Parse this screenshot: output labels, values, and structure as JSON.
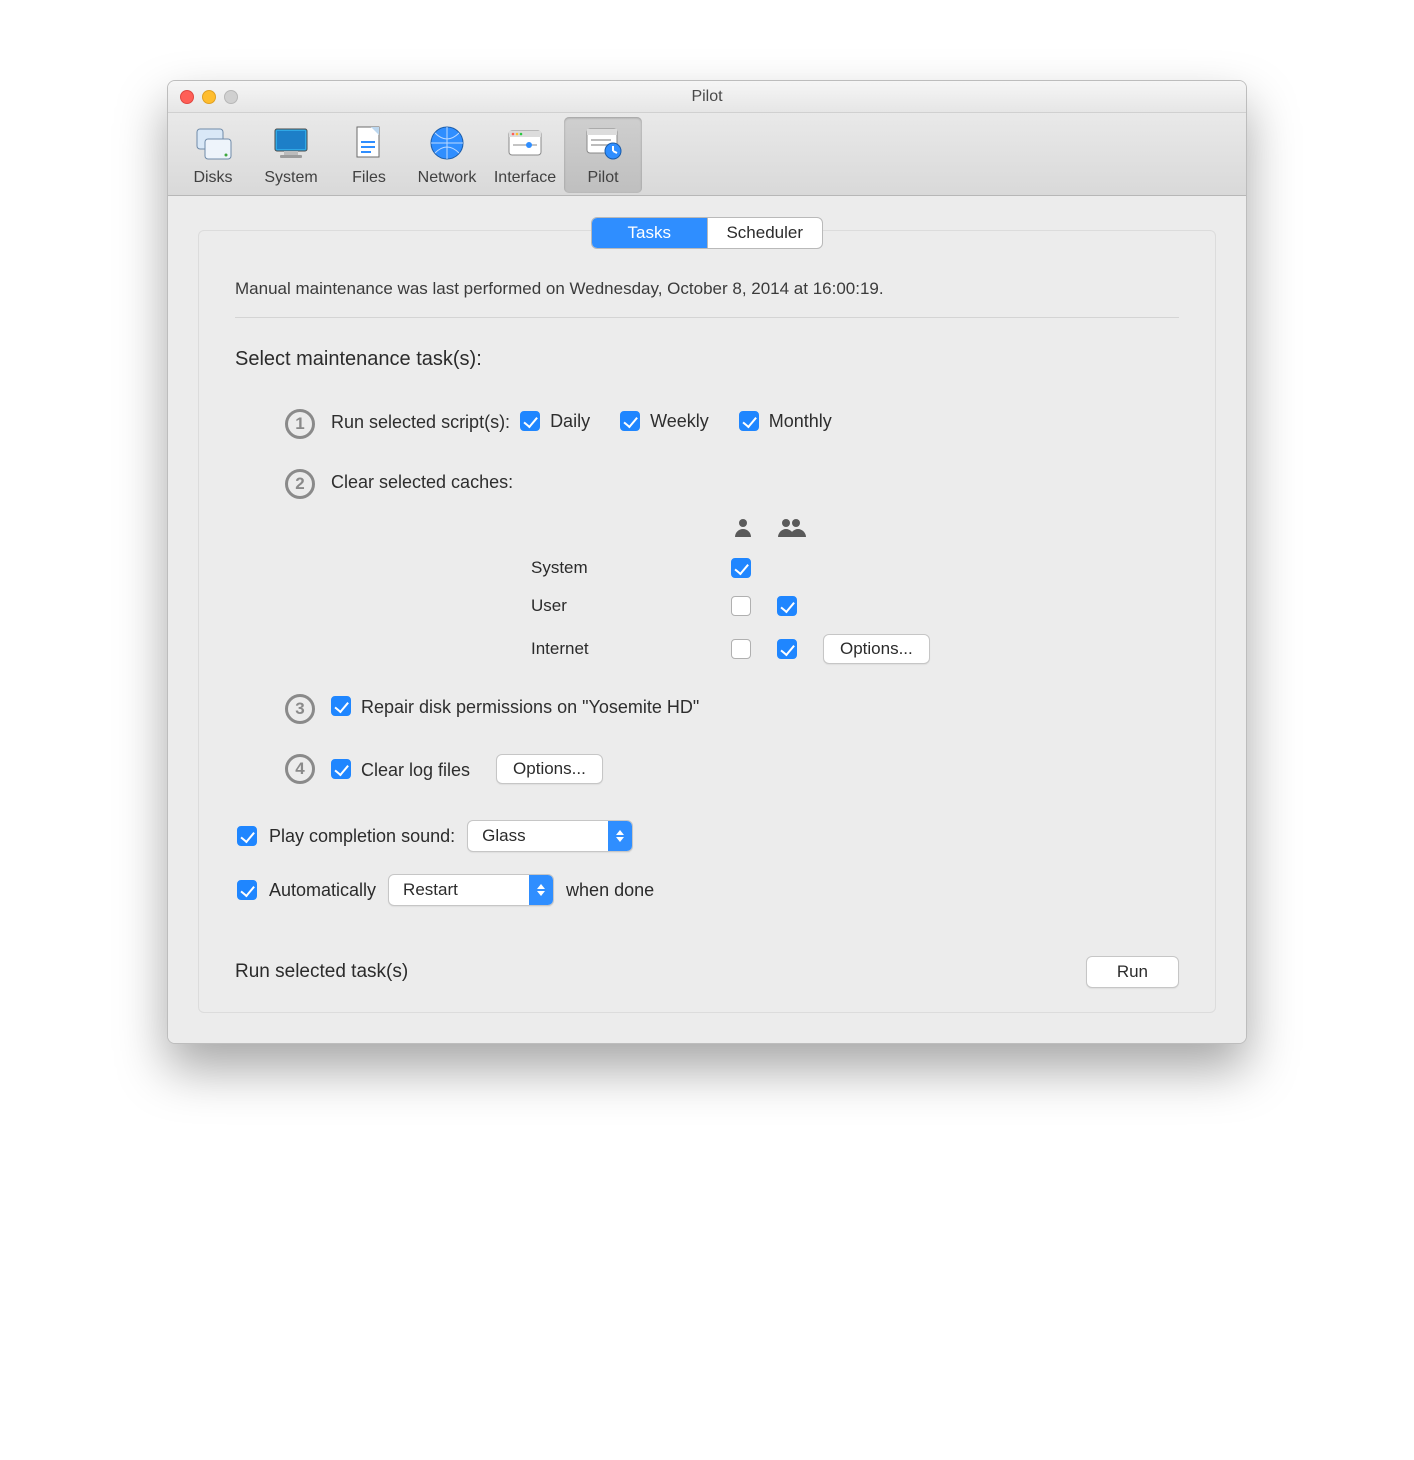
{
  "window": {
    "title": "Pilot"
  },
  "toolbar": {
    "items": [
      {
        "label": "Disks"
      },
      {
        "label": "System"
      },
      {
        "label": "Files"
      },
      {
        "label": "Network"
      },
      {
        "label": "Interface"
      },
      {
        "label": "Pilot"
      }
    ]
  },
  "tabs": {
    "tasks": "Tasks",
    "scheduler": "Scheduler"
  },
  "status_text": "Manual maintenance was last performed on Wednesday, October 8, 2014 at 16:00:19.",
  "section_head": "Select maintenance task(s):",
  "task1": {
    "num": "1",
    "label": "Run selected script(s):",
    "daily": "Daily",
    "weekly": "Weekly",
    "monthly": "Monthly"
  },
  "task2": {
    "num": "2",
    "label": "Clear selected caches:",
    "rows": {
      "system": "System",
      "user": "User",
      "internet": "Internet"
    },
    "options": "Options..."
  },
  "task3": {
    "num": "3",
    "label": "Repair disk permissions on \"Yosemite HD\""
  },
  "task4": {
    "num": "4",
    "label": "Clear log files",
    "options": "Options..."
  },
  "sound": {
    "label": "Play completion sound:",
    "value": "Glass"
  },
  "auto": {
    "label": "Automatically",
    "value": "Restart",
    "suffix": "when done"
  },
  "run": {
    "label": "Run selected task(s)",
    "button": "Run"
  }
}
